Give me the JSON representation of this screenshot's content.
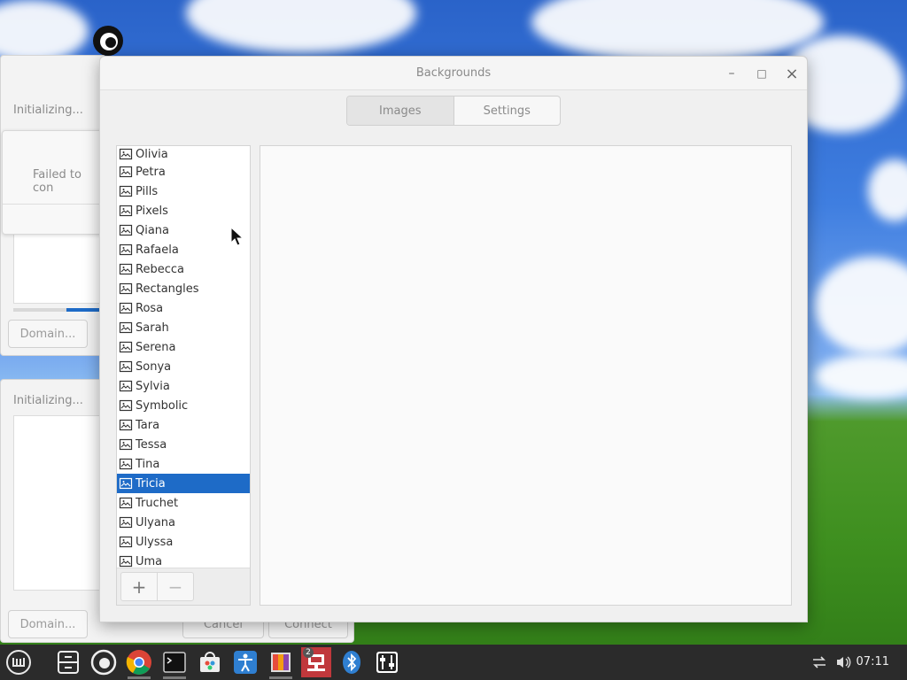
{
  "window": {
    "title": "Backgrounds",
    "minimize_symbol": "–",
    "maximize_symbol": "□",
    "close_symbol": "×",
    "tabs": [
      {
        "label": "Images",
        "active": true
      },
      {
        "label": "Settings",
        "active": false
      }
    ],
    "backgrounds": [
      {
        "name": "Olivia",
        "selected": false
      },
      {
        "name": "Petra",
        "selected": false
      },
      {
        "name": "Pills",
        "selected": false
      },
      {
        "name": "Pixels",
        "selected": false
      },
      {
        "name": "Qiana",
        "selected": false
      },
      {
        "name": "Rafaela",
        "selected": false
      },
      {
        "name": "Rebecca",
        "selected": false
      },
      {
        "name": "Rectangles",
        "selected": false
      },
      {
        "name": "Rosa",
        "selected": false
      },
      {
        "name": "Sarah",
        "selected": false
      },
      {
        "name": "Serena",
        "selected": false
      },
      {
        "name": "Sonya",
        "selected": false
      },
      {
        "name": "Sylvia",
        "selected": false
      },
      {
        "name": "Symbolic",
        "selected": false
      },
      {
        "name": "Tara",
        "selected": false
      },
      {
        "name": "Tessa",
        "selected": false
      },
      {
        "name": "Tina",
        "selected": false
      },
      {
        "name": "Tricia",
        "selected": true
      },
      {
        "name": "Truchet",
        "selected": false
      },
      {
        "name": "Ulyana",
        "selected": false
      },
      {
        "name": "Ulyssa",
        "selected": false
      },
      {
        "name": "Uma",
        "selected": false
      }
    ],
    "add_label": "+",
    "remove_label": "−"
  },
  "background_windows": {
    "top": {
      "status": "Initializing...",
      "dialog_text": "Failed to con",
      "domain_button": "Domain..."
    },
    "bottom": {
      "status": "Initializing...",
      "domain_button": "Domain...",
      "cancel_button": "Cancel",
      "connect_button": "Connect"
    }
  },
  "taskbar": {
    "apps": [
      {
        "name": "menu",
        "icon": "mint-menu-icon"
      },
      {
        "name": "files",
        "icon": "file-cabinet-icon"
      },
      {
        "name": "firefox",
        "icon": "firefox-icon"
      },
      {
        "name": "chrome",
        "icon": "chrome-icon"
      },
      {
        "name": "terminal",
        "icon": "terminal-icon"
      },
      {
        "name": "software",
        "icon": "software-manager-icon"
      },
      {
        "name": "accessibility",
        "icon": "accessibility-icon"
      },
      {
        "name": "backgrounds",
        "icon": "backgrounds-icon"
      },
      {
        "name": "network",
        "icon": "network-icon",
        "badge": "2"
      },
      {
        "name": "bluetooth",
        "icon": "bluetooth-icon"
      },
      {
        "name": "system-settings",
        "icon": "settings-icon"
      }
    ],
    "clock": "07:11"
  },
  "colors": {
    "accent": "#1e6bc7",
    "taskbar": "#2b2b2b",
    "active_app": "#c0383c"
  }
}
